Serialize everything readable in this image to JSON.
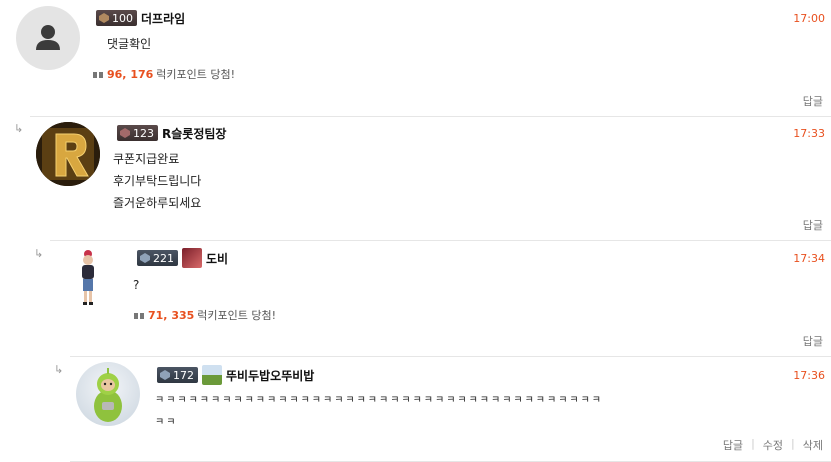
{
  "comments": [
    {
      "level": "100",
      "nick": "더프라임",
      "time": "17:00",
      "lines": [
        "댓글확인"
      ],
      "point_value": "96, 176",
      "point_suffix": "럭키포인트 당첨!",
      "actions": [
        "답글"
      ]
    },
    {
      "level": "123",
      "nick": "R슬롯정팀장",
      "time": "17:33",
      "lines": [
        "쿠폰지급완료",
        "후기부탁드립니다",
        "즐거운하루되세요"
      ],
      "actions": [
        "답글"
      ]
    },
    {
      "level": "221",
      "nick": "도비",
      "time": "17:34",
      "lines": [
        "?"
      ],
      "point_value": "71, 335",
      "point_suffix": "럭키포인트 당첨!",
      "actions": [
        "답글"
      ]
    },
    {
      "level": "172",
      "nick": "뚜비두밥오뚜비밥",
      "time": "17:36",
      "lines": [
        "ㅋㅋㅋㅋㅋㅋㅋㅋㅋㅋㅋㅋㅋㅋㅋㅋㅋㅋㅋㅋㅋㅋㅋㅋㅋㅋㅋㅋㅋㅋㅋㅋㅋㅋㅋㅋㅋㅋㅋㅋ",
        "ㅋㅋ"
      ],
      "actions": [
        "답글",
        "수정",
        "삭제"
      ]
    }
  ],
  "reply_arrow_glyph": "↳",
  "separator": "|"
}
